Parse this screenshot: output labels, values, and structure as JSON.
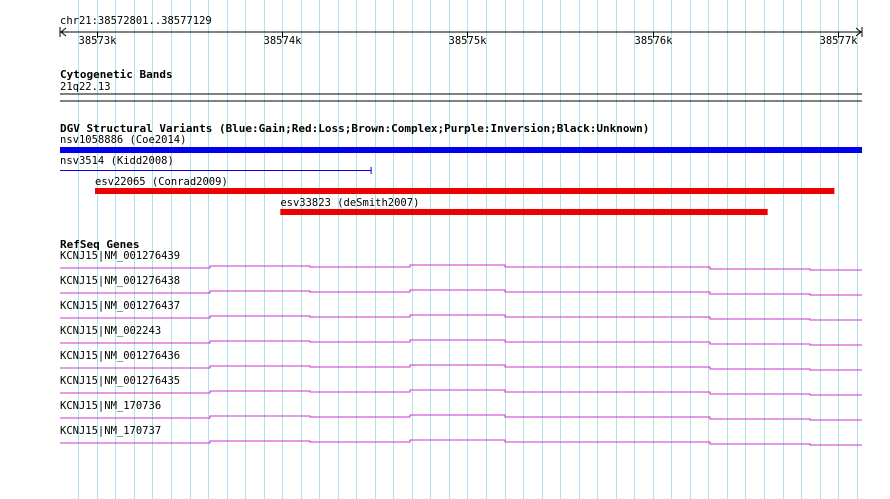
{
  "region": {
    "label": "chr21:38572801..38577129",
    "start": 38572801,
    "end": 38577129
  },
  "ruler": {
    "ticks": [
      {
        "pos": 38573000,
        "label": "38573k"
      },
      {
        "pos": 38574000,
        "label": "38574k"
      },
      {
        "pos": 38575000,
        "label": "38575k"
      },
      {
        "pos": 38576000,
        "label": "38576k"
      },
      {
        "pos": 38577000,
        "label": "38577k"
      }
    ],
    "grid_step": 100
  },
  "cytoband": {
    "title": "Cytogenetic Bands",
    "band_label": "21q22.13"
  },
  "dgv": {
    "title": "DGV Structural Variants (Blue:Gain;Red:Loss;Brown:Complex;Purple:Inversion;Black:Unknown)",
    "variants": [
      {
        "label": "nsv1058886 (Coe2014)",
        "start": 38572801,
        "end": 38577129,
        "type": "gain",
        "color": "#0000ee",
        "thick": true
      },
      {
        "label": "nsv3514 (Kidd2008)",
        "start": 38572801,
        "end": 38574480,
        "type": "gain",
        "color": "#0000ee",
        "thick": false
      },
      {
        "label": "esv22065 (Conrad2009)",
        "start": 38572990,
        "end": 38576980,
        "type": "loss",
        "color": "#ee0000",
        "thick": true
      },
      {
        "label": "esv33823 (deSmith2007)",
        "start": 38573990,
        "end": 38576620,
        "type": "loss",
        "color": "#ee0000",
        "thick": true
      }
    ]
  },
  "refseq": {
    "title": "RefSeq Genes",
    "genes": [
      {
        "label": "KCNJ15|NM_001276439"
      },
      {
        "label": "KCNJ15|NM_001276438"
      },
      {
        "label": "KCNJ15|NM_001276437"
      },
      {
        "label": "KCNJ15|NM_002243"
      },
      {
        "label": "KCNJ15|NM_001276436"
      },
      {
        "label": "KCNJ15|NM_001276435"
      },
      {
        "label": "KCNJ15|NM_170736"
      },
      {
        "label": "KCNJ15|NM_170737"
      }
    ],
    "color": "#cc33cc"
  },
  "colors": {
    "grid": "#b0e0ee",
    "text": "#000000",
    "ruler": "#000000"
  }
}
